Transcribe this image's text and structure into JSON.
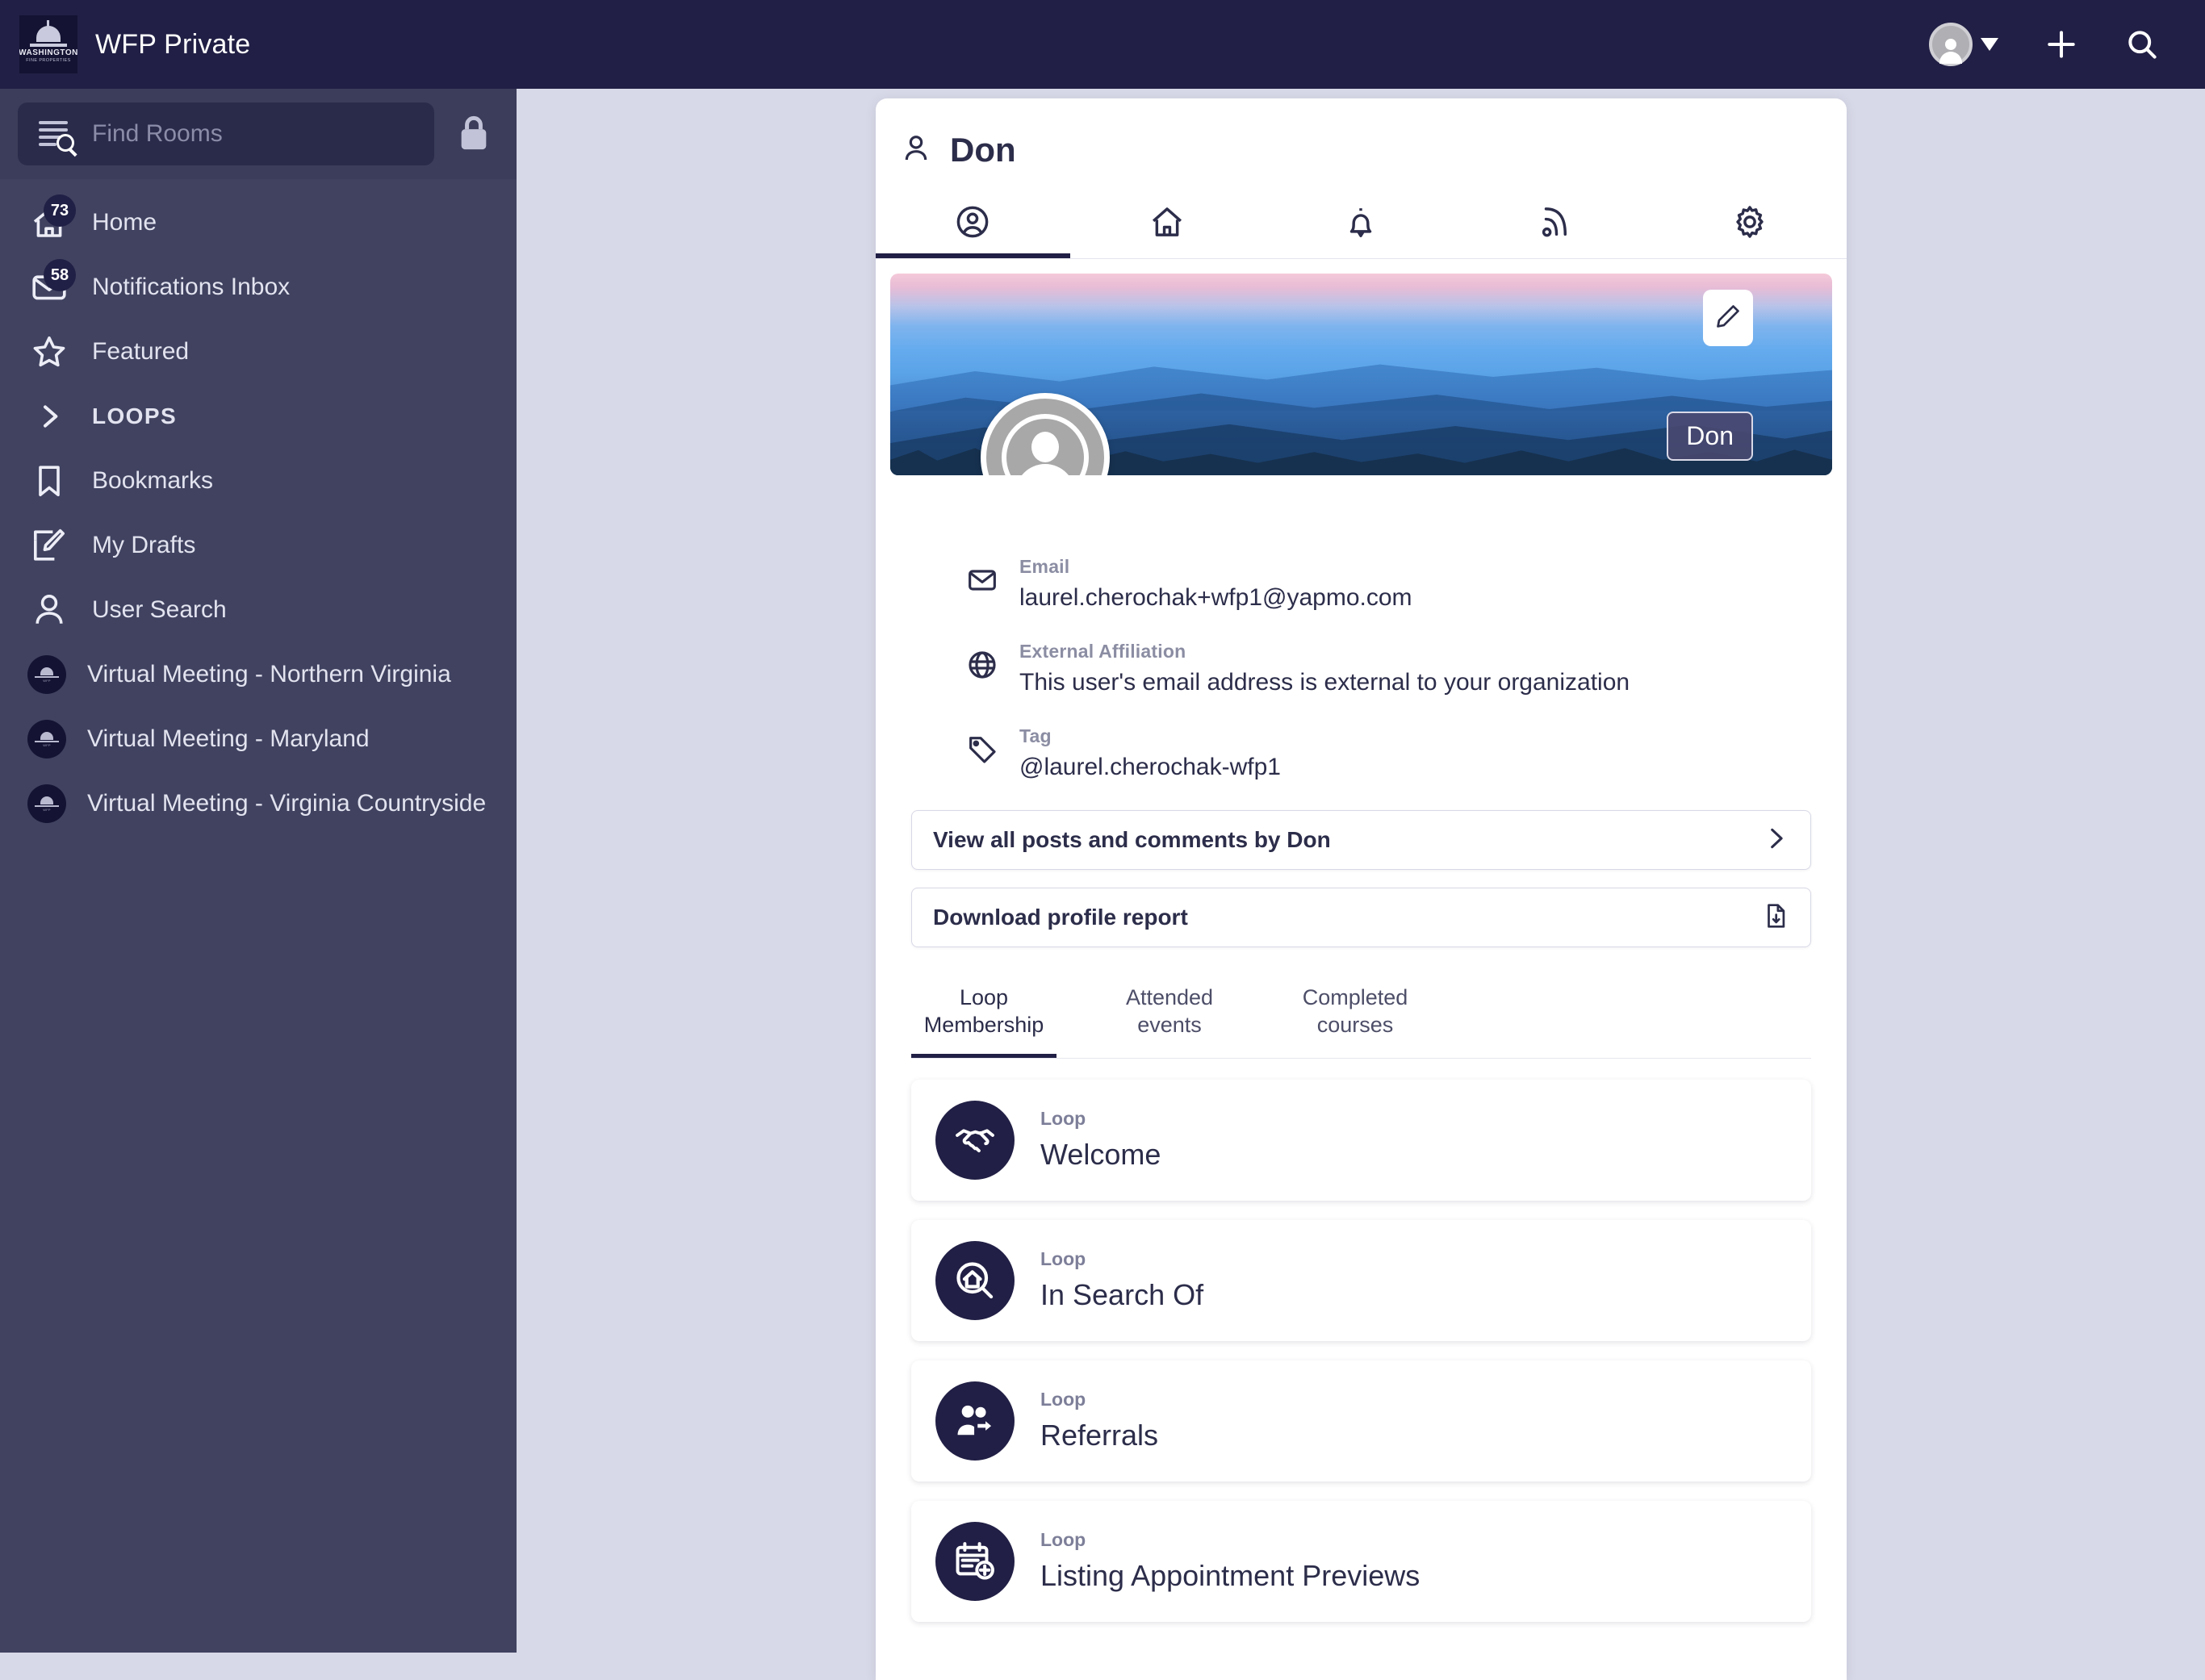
{
  "topbar": {
    "brand_title": "WFP Private",
    "logo_text": "WASHINGTON",
    "logo_subtext": "FINE PROPERTIES",
    "avatar_icon": "user-avatar-icon",
    "caret_icon": "chevron-down-icon",
    "add_icon": "plus-icon",
    "search_icon": "search-icon",
    "bg_color": "#211f45"
  },
  "sidebar": {
    "search_placeholder": "Find Rooms",
    "search_value": "",
    "search_icon": "find-rooms-icon",
    "lock_icon": "lock-icon",
    "bg_color": "#404260",
    "items": [
      {
        "label": "Home",
        "icon": "home-icon",
        "badge": "73"
      },
      {
        "label": "Notifications Inbox",
        "icon": "envelope-icon",
        "badge": "58"
      },
      {
        "label": "Featured",
        "icon": "star-icon",
        "badge": ""
      },
      {
        "label": "LOOPS",
        "icon": "chevron-right-icon",
        "badge": ""
      },
      {
        "label": "Bookmarks",
        "icon": "bookmark-icon",
        "badge": ""
      },
      {
        "label": "My Drafts",
        "icon": "pencil-square-icon",
        "badge": ""
      },
      {
        "label": "User Search",
        "icon": "person-icon",
        "badge": ""
      },
      {
        "label": "Virtual Meeting - Northern Virginia",
        "icon": "room-avatar-icon",
        "badge": ""
      },
      {
        "label": "Virtual Meeting - Maryland",
        "icon": "room-avatar-icon",
        "badge": ""
      },
      {
        "label": "Virtual Meeting - Virginia Countryside",
        "icon": "room-avatar-icon",
        "badge": ""
      }
    ]
  },
  "profile": {
    "title": "Don",
    "title_icon": "person-icon",
    "tabs": [
      {
        "icon": "profile-circle-icon",
        "active": true
      },
      {
        "icon": "home-icon",
        "active": false
      },
      {
        "icon": "bell-icon",
        "active": false
      },
      {
        "icon": "rss-icon",
        "active": false
      },
      {
        "icon": "gear-icon",
        "active": false
      }
    ],
    "banner": {
      "edit_icon": "pencil-icon",
      "name_chip": "Don",
      "avatar_icon": "default-avatar-icon"
    },
    "details": [
      {
        "icon": "envelope-icon",
        "label": "Email",
        "value": "laurel.cherochak+wfp1@yapmo.com"
      },
      {
        "icon": "globe-icon",
        "label": "External Affiliation",
        "value": "This user's email address is external to your organization"
      },
      {
        "icon": "tag-icon",
        "label": "Tag",
        "value": "@laurel.cherochak-wfp1"
      }
    ],
    "actions": [
      {
        "label": "View all posts and comments by Don",
        "icon": "chevron-right-icon"
      },
      {
        "label": "Download profile report",
        "icon": "file-download-icon"
      }
    ],
    "subtabs": [
      {
        "label": "Loop Membership",
        "active": true
      },
      {
        "label": "Attended events",
        "active": false
      },
      {
        "label": "Completed courses",
        "active": false
      }
    ],
    "loops": [
      {
        "kind": "Loop",
        "name": "Welcome",
        "icon": "handshake-icon"
      },
      {
        "kind": "Loop",
        "name": "In Search Of",
        "icon": "house-search-icon"
      },
      {
        "kind": "Loop",
        "name": "Referrals",
        "icon": "people-referral-icon"
      },
      {
        "kind": "Loop",
        "name": "Listing Appointment Previews",
        "icon": "calendar-plus-icon"
      }
    ]
  }
}
